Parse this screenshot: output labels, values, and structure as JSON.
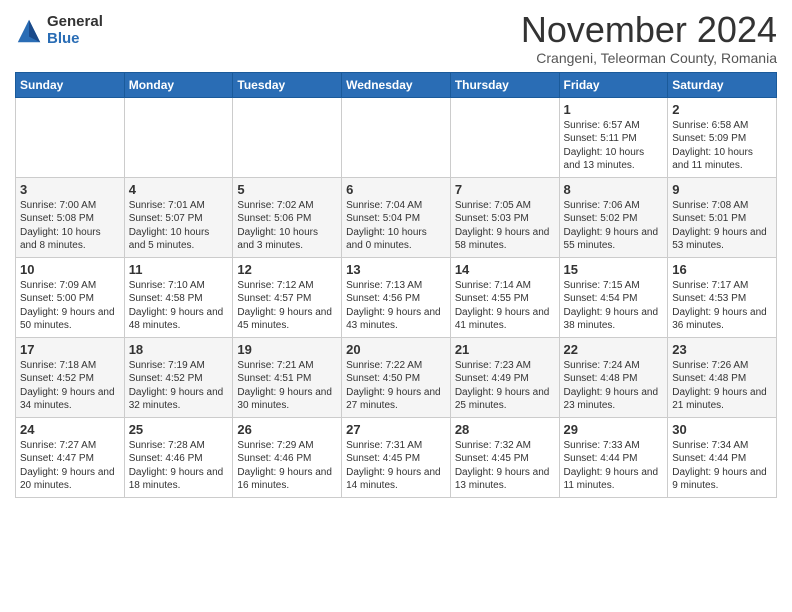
{
  "header": {
    "logo_general": "General",
    "logo_blue": "Blue",
    "title": "November 2024",
    "subtitle": "Crangeni, Teleorman County, Romania"
  },
  "days_of_week": [
    "Sunday",
    "Monday",
    "Tuesday",
    "Wednesday",
    "Thursday",
    "Friday",
    "Saturday"
  ],
  "weeks": [
    [
      {
        "day": "",
        "info": ""
      },
      {
        "day": "",
        "info": ""
      },
      {
        "day": "",
        "info": ""
      },
      {
        "day": "",
        "info": ""
      },
      {
        "day": "",
        "info": ""
      },
      {
        "day": "1",
        "info": "Sunrise: 6:57 AM\nSunset: 5:11 PM\nDaylight: 10 hours and 13 minutes."
      },
      {
        "day": "2",
        "info": "Sunrise: 6:58 AM\nSunset: 5:09 PM\nDaylight: 10 hours and 11 minutes."
      }
    ],
    [
      {
        "day": "3",
        "info": "Sunrise: 7:00 AM\nSunset: 5:08 PM\nDaylight: 10 hours and 8 minutes."
      },
      {
        "day": "4",
        "info": "Sunrise: 7:01 AM\nSunset: 5:07 PM\nDaylight: 10 hours and 5 minutes."
      },
      {
        "day": "5",
        "info": "Sunrise: 7:02 AM\nSunset: 5:06 PM\nDaylight: 10 hours and 3 minutes."
      },
      {
        "day": "6",
        "info": "Sunrise: 7:04 AM\nSunset: 5:04 PM\nDaylight: 10 hours and 0 minutes."
      },
      {
        "day": "7",
        "info": "Sunrise: 7:05 AM\nSunset: 5:03 PM\nDaylight: 9 hours and 58 minutes."
      },
      {
        "day": "8",
        "info": "Sunrise: 7:06 AM\nSunset: 5:02 PM\nDaylight: 9 hours and 55 minutes."
      },
      {
        "day": "9",
        "info": "Sunrise: 7:08 AM\nSunset: 5:01 PM\nDaylight: 9 hours and 53 minutes."
      }
    ],
    [
      {
        "day": "10",
        "info": "Sunrise: 7:09 AM\nSunset: 5:00 PM\nDaylight: 9 hours and 50 minutes."
      },
      {
        "day": "11",
        "info": "Sunrise: 7:10 AM\nSunset: 4:58 PM\nDaylight: 9 hours and 48 minutes."
      },
      {
        "day": "12",
        "info": "Sunrise: 7:12 AM\nSunset: 4:57 PM\nDaylight: 9 hours and 45 minutes."
      },
      {
        "day": "13",
        "info": "Sunrise: 7:13 AM\nSunset: 4:56 PM\nDaylight: 9 hours and 43 minutes."
      },
      {
        "day": "14",
        "info": "Sunrise: 7:14 AM\nSunset: 4:55 PM\nDaylight: 9 hours and 41 minutes."
      },
      {
        "day": "15",
        "info": "Sunrise: 7:15 AM\nSunset: 4:54 PM\nDaylight: 9 hours and 38 minutes."
      },
      {
        "day": "16",
        "info": "Sunrise: 7:17 AM\nSunset: 4:53 PM\nDaylight: 9 hours and 36 minutes."
      }
    ],
    [
      {
        "day": "17",
        "info": "Sunrise: 7:18 AM\nSunset: 4:52 PM\nDaylight: 9 hours and 34 minutes."
      },
      {
        "day": "18",
        "info": "Sunrise: 7:19 AM\nSunset: 4:52 PM\nDaylight: 9 hours and 32 minutes."
      },
      {
        "day": "19",
        "info": "Sunrise: 7:21 AM\nSunset: 4:51 PM\nDaylight: 9 hours and 30 minutes."
      },
      {
        "day": "20",
        "info": "Sunrise: 7:22 AM\nSunset: 4:50 PM\nDaylight: 9 hours and 27 minutes."
      },
      {
        "day": "21",
        "info": "Sunrise: 7:23 AM\nSunset: 4:49 PM\nDaylight: 9 hours and 25 minutes."
      },
      {
        "day": "22",
        "info": "Sunrise: 7:24 AM\nSunset: 4:48 PM\nDaylight: 9 hours and 23 minutes."
      },
      {
        "day": "23",
        "info": "Sunrise: 7:26 AM\nSunset: 4:48 PM\nDaylight: 9 hours and 21 minutes."
      }
    ],
    [
      {
        "day": "24",
        "info": "Sunrise: 7:27 AM\nSunset: 4:47 PM\nDaylight: 9 hours and 20 minutes."
      },
      {
        "day": "25",
        "info": "Sunrise: 7:28 AM\nSunset: 4:46 PM\nDaylight: 9 hours and 18 minutes."
      },
      {
        "day": "26",
        "info": "Sunrise: 7:29 AM\nSunset: 4:46 PM\nDaylight: 9 hours and 16 minutes."
      },
      {
        "day": "27",
        "info": "Sunrise: 7:31 AM\nSunset: 4:45 PM\nDaylight: 9 hours and 14 minutes."
      },
      {
        "day": "28",
        "info": "Sunrise: 7:32 AM\nSunset: 4:45 PM\nDaylight: 9 hours and 13 minutes."
      },
      {
        "day": "29",
        "info": "Sunrise: 7:33 AM\nSunset: 4:44 PM\nDaylight: 9 hours and 11 minutes."
      },
      {
        "day": "30",
        "info": "Sunrise: 7:34 AM\nSunset: 4:44 PM\nDaylight: 9 hours and 9 minutes."
      }
    ]
  ]
}
